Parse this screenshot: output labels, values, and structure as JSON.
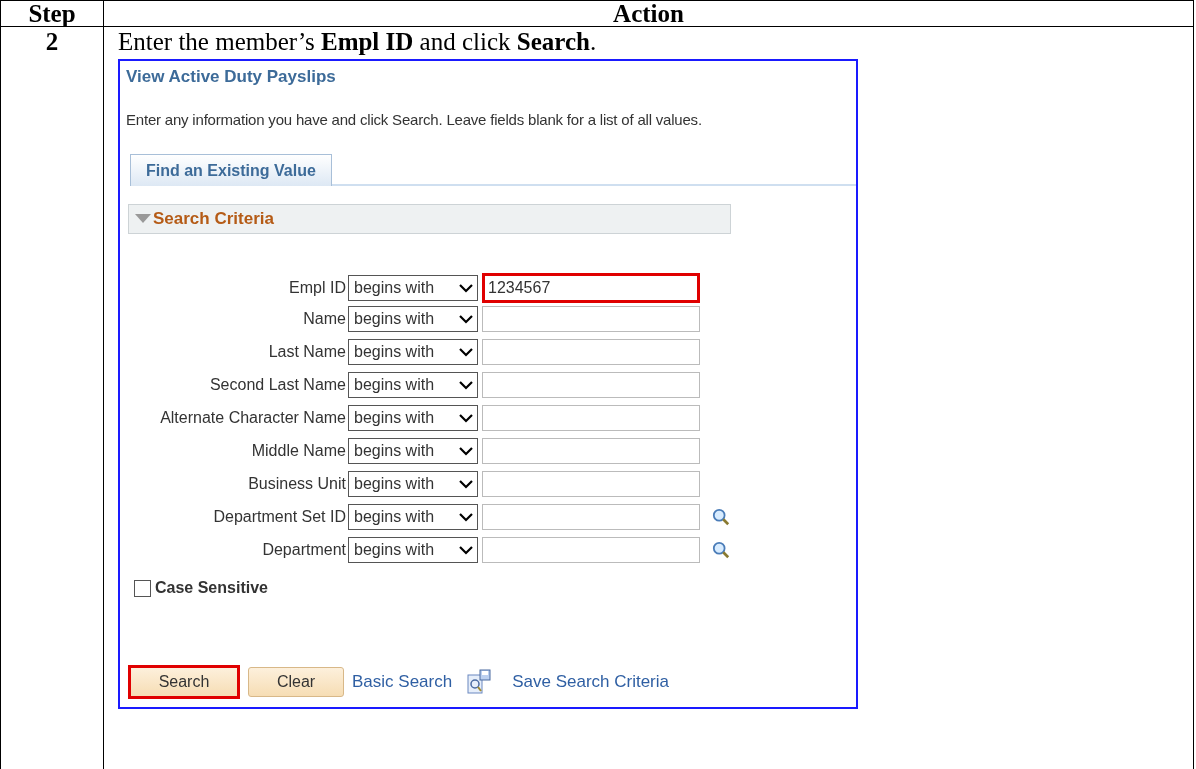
{
  "table": {
    "columns": [
      "Step",
      "Action"
    ],
    "rows": [
      {
        "step": "2",
        "instruction": "Enter the member’s **Empl ID** and click **Search**.",
        "screenshot": {
          "title": "View Active Duty Payslips",
          "intro": "Enter any information you have and click Search. Leave fields blank for a list of all values.",
          "tabs": [
            {
              "label": "Find an Existing Value",
              "selected": true
            }
          ],
          "section": {
            "title": "Search Criteria",
            "expanded": true
          },
          "fields": [
            {
              "label": "Empl ID",
              "operator": "begins with",
              "value": "1234567",
              "highlighted": true,
              "lookup": false
            },
            {
              "label": "Name",
              "operator": "begins with",
              "highlighted": false,
              "lookup": false
            },
            {
              "label": "Last Name",
              "operator": "begins with",
              "highlighted": false,
              "lookup": false
            },
            {
              "label": "Second Last Name",
              "operator": "begins with",
              "highlighted": false,
              "lookup": false
            },
            {
              "label": "Alternate Character Name",
              "operator": "begins with",
              "highlighted": false,
              "lookup": false
            },
            {
              "label": "Middle Name",
              "operator": "begins with",
              "highlighted": false,
              "lookup": false
            },
            {
              "label": "Business Unit",
              "operator": "begins with",
              "highlighted": false,
              "lookup": false
            },
            {
              "label": "Department Set ID",
              "operator": "begins with",
              "highlighted": false,
              "lookup": true
            },
            {
              "label": "Department",
              "operator": "begins with",
              "highlighted": false,
              "lookup": true
            }
          ],
          "case_sensitive": {
            "label": "Case Sensitive",
            "checked": false
          },
          "buttons": [
            {
              "label": "Search",
              "highlighted": true
            },
            {
              "label": "Clear",
              "highlighted": false
            }
          ],
          "links": [
            {
              "kind": "link",
              "label": "Basic Search"
            },
            {
              "kind": "icon-link",
              "label": "Save Search Criteria"
            }
          ]
        }
      }
    ]
  }
}
